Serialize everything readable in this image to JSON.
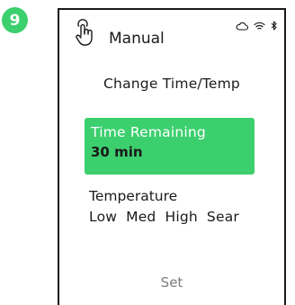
{
  "step": {
    "number": "9",
    "color": "#3ccf6e"
  },
  "header": {
    "mode_icon": "touch-hand-icon",
    "mode_label": "Manual",
    "status_icons": [
      "cloud-icon",
      "wifi-icon",
      "bluetooth-icon"
    ]
  },
  "screen": {
    "title": "Change Time/Temp",
    "time_card": {
      "label": "Time Remaining",
      "value": "30 min",
      "highlight_color": "#3ccf6e"
    },
    "temperature": {
      "label": "Temperature",
      "options": [
        "Low",
        "Med",
        "High",
        "Sear"
      ]
    },
    "set_label": "Set"
  }
}
